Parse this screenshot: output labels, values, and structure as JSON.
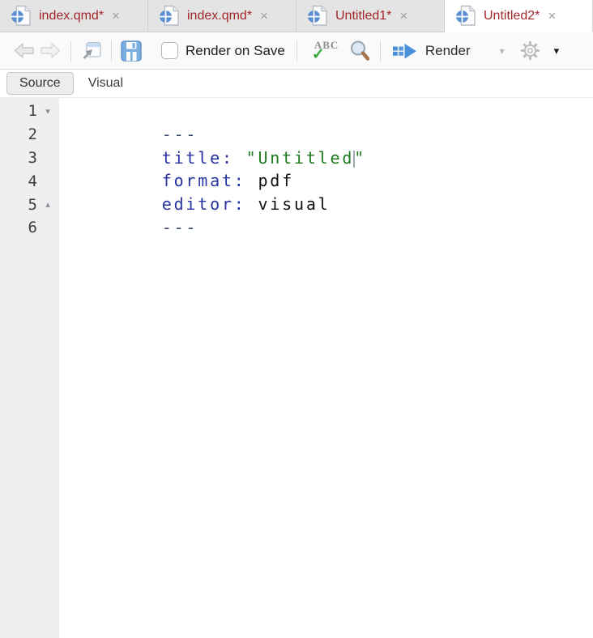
{
  "tabs": [
    {
      "label": "index.qmd*",
      "active": false
    },
    {
      "label": "index.qmd*",
      "active": false
    },
    {
      "label": "Untitled1*",
      "active": false
    },
    {
      "label": "Untitled2*",
      "active": true
    }
  ],
  "glyphs": {
    "close": "×",
    "caret_down": "▾",
    "fold_open": "▾",
    "fold_close": "▴",
    "check": "✓"
  },
  "toolbar": {
    "render_on_save": "Render on Save",
    "spellcheck_text": "ABC",
    "render": "Render"
  },
  "mode_toggle": {
    "source": "Source",
    "visual": "Visual"
  },
  "editor": {
    "lines": [
      {
        "number": "1",
        "fold": "▾",
        "code": [
          {
            "t": "---",
            "c": "meta"
          }
        ]
      },
      {
        "number": "2",
        "fold": "",
        "code": [
          {
            "t": "title:",
            "c": "key"
          },
          {
            "t": " ",
            "c": "plain"
          },
          {
            "t": "\"Untitled",
            "c": "str"
          },
          {
            "t": "\"",
            "c": "str"
          }
        ],
        "cursor_after_token": 2
      },
      {
        "number": "3",
        "fold": "",
        "code": [
          {
            "t": "format:",
            "c": "key"
          },
          {
            "t": " pdf",
            "c": "plain"
          }
        ]
      },
      {
        "number": "4",
        "fold": "",
        "code": [
          {
            "t": "editor:",
            "c": "key"
          },
          {
            "t": " visual",
            "c": "plain"
          }
        ]
      },
      {
        "number": "5",
        "fold": "▴",
        "code": [
          {
            "t": "---",
            "c": "meta"
          }
        ]
      },
      {
        "number": "6",
        "fold": "",
        "code": []
      }
    ]
  },
  "colors": {
    "tab_modified_red": "#a1262c",
    "save_blue": "#79aede",
    "render_blue": "#4a90d9",
    "string_green": "#1e7a1e",
    "key_blue": "#2633a0",
    "meta_navy": "#354368",
    "check_green": "#33a833",
    "gutter_bg": "#efefef",
    "tabbar_bg": "#e4e4e4"
  }
}
